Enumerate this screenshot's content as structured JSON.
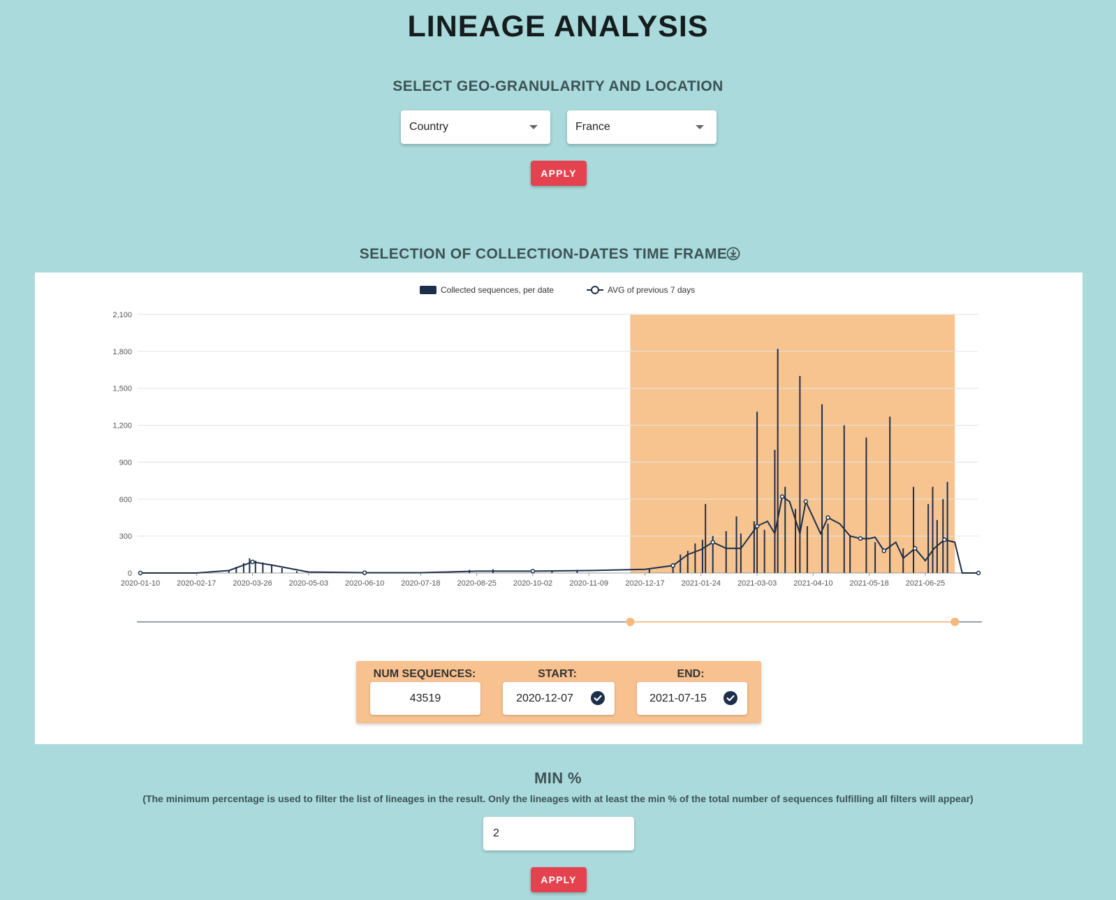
{
  "page": {
    "title": "LINEAGE ANALYSIS",
    "geo_section_title": "SELECT GEO-GRANULARITY AND LOCATION",
    "granularity_value": "Country",
    "location_value": "France",
    "apply_label": "APPLY",
    "timeframe_section_title": "SELECTION OF COLLECTION-DATES TIME FRAME",
    "download_icon": "download-icon",
    "min_title": "MIN %",
    "min_description": "(The minimum percentage is used to filter the list of lineages in the result. Only the lineages with at least the min % of the total number of sequences fulfilling all filters will appear)",
    "min_value": "2",
    "apply2_label": "APPLY"
  },
  "summary": {
    "num_sequences_label": "NUM SEQUENCES:",
    "num_sequences_value": "43519",
    "start_label": "START:",
    "start_value": "2020-12-07",
    "end_label": "END:",
    "end_value": "2021-07-15"
  },
  "colors": {
    "background": "#aadadb",
    "bars": "#1c2f4a",
    "selection": "#f7c490",
    "button": "#e5424f"
  },
  "chart_data": {
    "type": "bar",
    "title": "",
    "legend": [
      "Collected sequences, per date",
      "AVG of previous 7 days"
    ],
    "legend_position": "top-center",
    "yticks": [
      "0",
      "300",
      "600",
      "900",
      "1,200",
      "1,500",
      "1,800",
      "2,100"
    ],
    "ylim": [
      0,
      2100
    ],
    "xticks": [
      "2020-01-10",
      "2020-02-17",
      "2020-03-26",
      "2020-05-03",
      "2020-06-10",
      "2020-07-18",
      "2020-08-25",
      "2020-10-02",
      "2020-11-09",
      "2020-12-17",
      "2021-01-24",
      "2021-03-03",
      "2021-04-10",
      "2021-05-18",
      "2021-06-25"
    ],
    "xrange": [
      "2020-01-10",
      "2021-07-31"
    ],
    "selected_range": [
      "2020-12-07",
      "2021-07-15"
    ],
    "grid": true,
    "series": [
      {
        "name": "Collected sequences, per date",
        "type": "bar",
        "points": [
          [
            "2020-03-10",
            20
          ],
          [
            "2020-03-15",
            50
          ],
          [
            "2020-03-20",
            80
          ],
          [
            "2020-03-24",
            120
          ],
          [
            "2020-03-28",
            100
          ],
          [
            "2020-04-02",
            85
          ],
          [
            "2020-04-08",
            70
          ],
          [
            "2020-04-15",
            40
          ],
          [
            "2020-04-25",
            15
          ],
          [
            "2020-08-20",
            25
          ],
          [
            "2020-09-05",
            30
          ],
          [
            "2020-10-15",
            22
          ],
          [
            "2020-11-01",
            25
          ],
          [
            "2020-12-20",
            40
          ],
          [
            "2021-01-05",
            80
          ],
          [
            "2021-01-10",
            150
          ],
          [
            "2021-01-15",
            180
          ],
          [
            "2021-01-20",
            240
          ],
          [
            "2021-01-25",
            270
          ],
          [
            "2021-01-27",
            560
          ],
          [
            "2021-02-01",
            300
          ],
          [
            "2021-02-10",
            340
          ],
          [
            "2021-02-17",
            460
          ],
          [
            "2021-02-20",
            320
          ],
          [
            "2021-03-01",
            420
          ],
          [
            "2021-03-03",
            1310
          ],
          [
            "2021-03-08",
            350
          ],
          [
            "2021-03-15",
            1000
          ],
          [
            "2021-03-17",
            1820
          ],
          [
            "2021-03-22",
            700
          ],
          [
            "2021-03-29",
            520
          ],
          [
            "2021-04-01",
            1600
          ],
          [
            "2021-04-06",
            380
          ],
          [
            "2021-04-16",
            1370
          ],
          [
            "2021-04-20",
            400
          ],
          [
            "2021-05-01",
            1200
          ],
          [
            "2021-05-05",
            300
          ],
          [
            "2021-05-16",
            1100
          ],
          [
            "2021-05-22",
            250
          ],
          [
            "2021-06-01",
            1270
          ],
          [
            "2021-06-10",
            200
          ],
          [
            "2021-06-17",
            700
          ],
          [
            "2021-06-27",
            560
          ],
          [
            "2021-06-30",
            700
          ],
          [
            "2021-07-03",
            430
          ],
          [
            "2021-07-07",
            600
          ],
          [
            "2021-07-10",
            740
          ]
        ]
      },
      {
        "name": "AVG of previous 7 days",
        "type": "line",
        "points": [
          [
            "2020-01-10",
            0
          ],
          [
            "2020-02-17",
            0
          ],
          [
            "2020-03-10",
            20
          ],
          [
            "2020-03-26",
            90
          ],
          [
            "2020-04-10",
            60
          ],
          [
            "2020-05-03",
            8
          ],
          [
            "2020-06-10",
            2
          ],
          [
            "2020-07-18",
            2
          ],
          [
            "2020-08-25",
            15
          ],
          [
            "2020-10-02",
            15
          ],
          [
            "2020-11-09",
            20
          ],
          [
            "2020-12-17",
            30
          ],
          [
            "2021-01-05",
            60
          ],
          [
            "2021-01-15",
            150
          ],
          [
            "2021-01-24",
            190
          ],
          [
            "2021-02-01",
            250
          ],
          [
            "2021-02-10",
            200
          ],
          [
            "2021-02-20",
            200
          ],
          [
            "2021-03-03",
            380
          ],
          [
            "2021-03-10",
            420
          ],
          [
            "2021-03-15",
            320
          ],
          [
            "2021-03-20",
            620
          ],
          [
            "2021-03-25",
            580
          ],
          [
            "2021-04-01",
            320
          ],
          [
            "2021-04-05",
            580
          ],
          [
            "2021-04-10",
            450
          ],
          [
            "2021-04-15",
            320
          ],
          [
            "2021-04-20",
            450
          ],
          [
            "2021-04-28",
            400
          ],
          [
            "2021-05-05",
            300
          ],
          [
            "2021-05-12",
            280
          ],
          [
            "2021-05-18",
            280
          ],
          [
            "2021-05-22",
            290
          ],
          [
            "2021-05-28",
            180
          ],
          [
            "2021-06-05",
            250
          ],
          [
            "2021-06-10",
            120
          ],
          [
            "2021-06-18",
            200
          ],
          [
            "2021-06-25",
            100
          ],
          [
            "2021-07-01",
            200
          ],
          [
            "2021-07-08",
            270
          ],
          [
            "2021-07-15",
            250
          ],
          [
            "2021-07-20",
            0
          ],
          [
            "2021-07-31",
            0
          ]
        ]
      }
    ]
  }
}
